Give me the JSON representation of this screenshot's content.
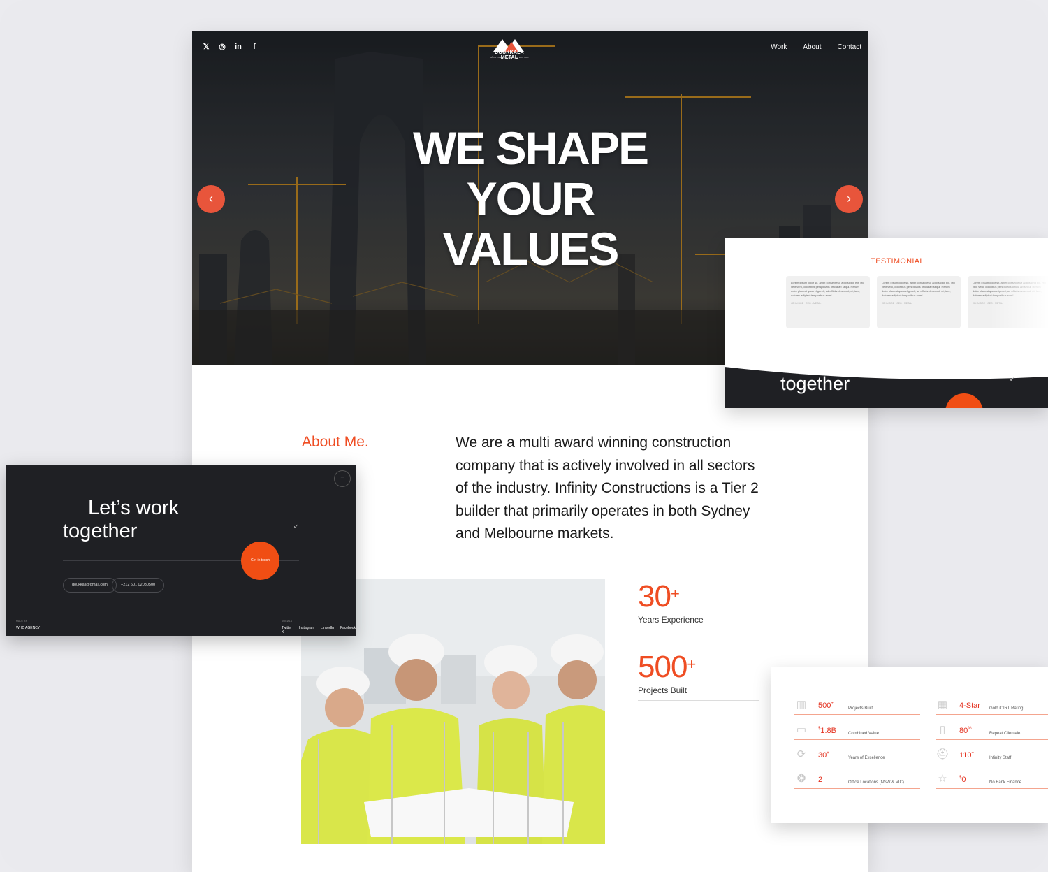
{
  "colors": {
    "accent": "#ef4d23",
    "dark": "#1f2024"
  },
  "hero": {
    "logo_text": "DOUKKALA METAL",
    "logo_sub": "BÂTIR PRESTIGE DE CONSTRUCTION",
    "title_lines": [
      "WE SHAPE",
      "YOUR",
      "VALUES"
    ],
    "nav": [
      "Work",
      "About",
      "Contact"
    ],
    "socials": [
      "X",
      "instagram",
      "in",
      "f"
    ],
    "prev_icon": "‹",
    "next_icon": "›"
  },
  "about": {
    "label": "About Me.",
    "text": "We are a multi award winning construction company that is actively involved in all sectors of the industry. Infinity Constructions is a Tier 2 builder that primarily operates in both Sydney and Melbourne markets."
  },
  "stats": [
    {
      "value": "30",
      "suffix": "+",
      "label": "Years Experience"
    },
    {
      "value": "500",
      "suffix": "+",
      "label": "Projects Built"
    }
  ],
  "testimonial": {
    "title": "TESTIMONIAL",
    "cards": [
      {
        "text": "Lorem ipsum dolor sit, amet consectetur adipisicing elit. Hic velit vero, doloribus perspiciatis officia ab sequi. Rerum dolor placeat quas eligendi, ad officiis deserunt, et, iure, dolores adipisci temporibus eum!",
        "author": "JOHN DOE · CEO - METAL"
      },
      {
        "text": "Lorem ipsum dolor sit, amet consectetur adipisicing elit. Hic velit vero, doloribus perspiciatis officia ab sequi. Rerum dolor placeat quas eligendi, ad officiis deserunt, et, iure, dolores adipisci temporibus eum!",
        "author": "JOHN DOE · CEO - METAL"
      },
      {
        "text": "Lorem ipsum dolor sit, amet consectetur adipisicing elit. Hic velit vero, doloribus perspiciatis officia ab sequi. Rerum dolor placeat quas eligendi, ad officiis deserunt, et, iure, dolores adipisci temporibus eum!",
        "author": "JOHN DOE · CEO - METAL"
      }
    ],
    "footer_text": "together"
  },
  "work": {
    "line1": "Let’s work",
    "line2": "together",
    "cta": "Get in touch",
    "email": "doukkali@gmail.com",
    "phone": "+212 601 02030500",
    "made_by_label": "MADE BY",
    "agency": "WHD AGENCY",
    "socials_label": "SOCIALS",
    "socials": [
      "Twitter X",
      "Instagram",
      "LinkedIn",
      "Facebook"
    ]
  },
  "stats_panel": {
    "rows": [
      {
        "icon": "building-icon",
        "value": "500",
        "suffix": "+",
        "label": "Projects Built"
      },
      {
        "icon": "star-building-icon",
        "value": "4-Star",
        "suffix": "",
        "label": "Gold iCIRT Rating"
      },
      {
        "icon": "presentation-icon",
        "value": "1.8B",
        "prefix": "$",
        "suffix": "",
        "label": "Combined Value"
      },
      {
        "icon": "door-icon",
        "value": "80",
        "suffix": "%",
        "label": "Repeat Clientele"
      },
      {
        "icon": "refresh-icon",
        "value": "30",
        "suffix": "+",
        "label": "Years of Excellence"
      },
      {
        "icon": "worker-icon",
        "value": "110",
        "suffix": "+",
        "label": "Infinity Staff"
      },
      {
        "icon": "award-icon",
        "value": "2",
        "suffix": "",
        "label": "Office Locations (NSW & VIC)"
      },
      {
        "icon": "star-icon",
        "value": "0",
        "prefix": "$",
        "suffix": "",
        "label": "No Bank Finance"
      }
    ]
  }
}
